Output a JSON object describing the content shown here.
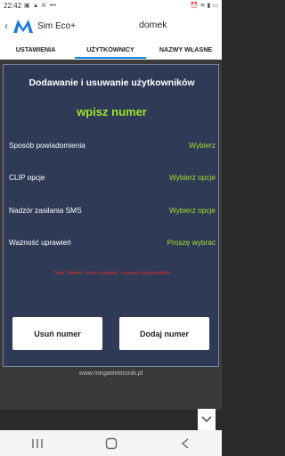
{
  "status": {
    "time": "22:42",
    "battery": ""
  },
  "app": {
    "name": "Sim Eco+",
    "device": "domek"
  },
  "tabs": [
    {
      "label": "USTAWIENIA"
    },
    {
      "label": "UŻYTKOWNICY"
    },
    {
      "label": "NAZWY WŁASNE"
    }
  ],
  "panel": {
    "title": "Dodawanie i usuwanie użytkowników",
    "subtitle": "wpisz numer",
    "rows": [
      {
        "label": "Sposób powiadomienia",
        "value": "Wybierz"
      },
      {
        "label": "CLIP opcje",
        "value": "Wybierz opcje"
      },
      {
        "label": "Nadzór zasilania SMS",
        "value": "Wybierz opcje"
      },
      {
        "label": "Ważność uprawień",
        "value": "Proszę wybrać"
      }
    ],
    "warning": "Tylko \"Master\" może dodawać i usuwać użytkowników",
    "buttons": {
      "remove": "Usuń numer",
      "add": "Dodaj numer"
    }
  },
  "footer": {
    "url": "www.megaelektronik.pl"
  },
  "colors": {
    "accent": "#1e88e5",
    "panel": "#2f3a56",
    "value_green": "#9fe22a",
    "warning_red": "#e0302a"
  }
}
